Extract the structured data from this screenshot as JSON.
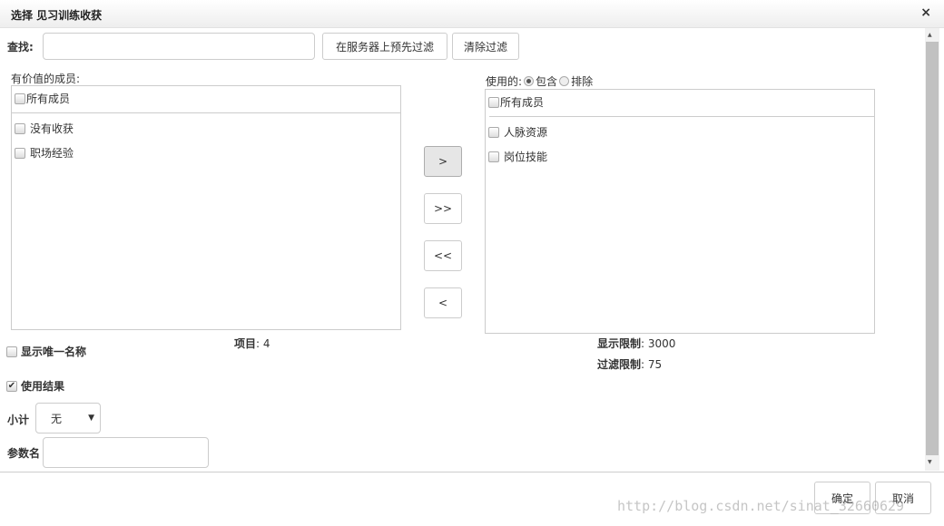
{
  "dialog": {
    "title": "选择 见习训练收获",
    "close": "×"
  },
  "search": {
    "label": "查找:",
    "value": "",
    "prefilter_button": "在服务器上预先过滤",
    "clear_button": "清除过滤"
  },
  "available": {
    "label": "有价值的成员:",
    "all": "所有成员",
    "items": [
      "没有收获",
      "职场经验"
    ],
    "count_label": "项目",
    "count": "4"
  },
  "transfer": {
    "add": ">",
    "add_all": ">>",
    "remove_all": "<<",
    "remove": "<"
  },
  "used": {
    "label": "使用的:",
    "include": "包含",
    "exclude": "排除",
    "all": "所有成员",
    "items": [
      "人脉资源",
      "岗位技能"
    ],
    "display_limit_label": "显示限制",
    "display_limit": "3000",
    "filter_limit_label": "过滤限制",
    "filter_limit": "75"
  },
  "options": {
    "unique_names": "显示唯一名称",
    "use_result": "使用结果",
    "subtotal_label": "小计",
    "subtotal_value": "无",
    "param_label": "参数名",
    "param_value": ""
  },
  "footer": {
    "ok": "确定",
    "cancel": "取消"
  },
  "watermark": "http://blog.csdn.net/sinat_32660629"
}
